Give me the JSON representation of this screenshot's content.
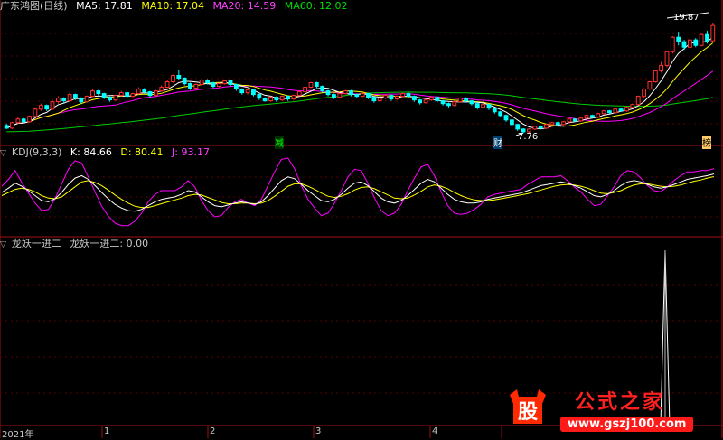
{
  "main_header": {
    "title": "广东鸿图(日线)",
    "ma": [
      {
        "label": "MA5: 17.81",
        "color": "#ffffff"
      },
      {
        "label": "MA10: 17.04",
        "color": "#ffff00"
      },
      {
        "label": "MA20: 14.59",
        "color": "#ff00ff"
      },
      {
        "label": "MA60: 12.02",
        "color": "#00e000"
      }
    ]
  },
  "kdj_header": {
    "title": "KDJ(9,3,3)",
    "k": "K: 84.66",
    "d": "D: 80.41",
    "j": "J: 93.17",
    "colors": {
      "k": "#ffffff",
      "d": "#ffff00",
      "j": "#ff00ff"
    }
  },
  "ind_header": {
    "title": "龙妖一进二",
    "value": "龙妖一进二: 0.00"
  },
  "markers": {
    "high": "19.87",
    "low": "7.76",
    "tag_jian": "减",
    "tag_cai": "财",
    "tag_right": "榜"
  },
  "time_axis": [
    "2021年",
    "1",
    "2",
    "3",
    "4"
  ],
  "watermark": {
    "glyph": "股",
    "text": "公式之家",
    "url": "www.gszj100.com"
  },
  "chart_data": [
    {
      "type": "candlestick",
      "price_ylim": [
        6.5,
        21
      ],
      "high_label": 19.87,
      "low_label": 7.76,
      "candles": [
        [
          8.6,
          8.3,
          8.8,
          8.2
        ],
        [
          8.3,
          8.9,
          9.0,
          8.2
        ],
        [
          8.9,
          9.3,
          9.5,
          8.8
        ],
        [
          9.3,
          9.0,
          9.4,
          8.9
        ],
        [
          9.0,
          9.6,
          9.7,
          8.9
        ],
        [
          9.6,
          10.4,
          10.6,
          9.5
        ],
        [
          10.4,
          10.8,
          11.0,
          10.2
        ],
        [
          10.8,
          10.4,
          10.9,
          10.2
        ],
        [
          10.4,
          11.2,
          11.4,
          10.3
        ],
        [
          11.2,
          11.6,
          11.8,
          11.0
        ],
        [
          11.6,
          11.3,
          11.7,
          11.0
        ],
        [
          11.3,
          12.0,
          12.2,
          11.2
        ],
        [
          12.0,
          11.6,
          12.1,
          11.4
        ],
        [
          11.6,
          11.2,
          11.7,
          11.0
        ],
        [
          11.2,
          11.8,
          11.9,
          11.1
        ],
        [
          11.8,
          12.4,
          12.6,
          11.7
        ],
        [
          12.4,
          12.1,
          12.5,
          11.9
        ],
        [
          12.1,
          11.7,
          12.2,
          11.5
        ],
        [
          11.7,
          11.4,
          11.8,
          11.2
        ],
        [
          11.4,
          11.9,
          12.0,
          11.3
        ],
        [
          11.9,
          12.2,
          12.4,
          11.8
        ],
        [
          12.2,
          11.8,
          12.3,
          11.6
        ],
        [
          11.8,
          12.1,
          12.2,
          11.7
        ],
        [
          12.1,
          12.6,
          12.8,
          12.0
        ],
        [
          12.6,
          12.3,
          12.7,
          12.1
        ],
        [
          12.3,
          11.9,
          12.4,
          11.7
        ],
        [
          11.9,
          12.4,
          12.5,
          11.8
        ],
        [
          12.4,
          12.8,
          13.0,
          12.3
        ],
        [
          12.8,
          13.4,
          13.6,
          12.7
        ],
        [
          13.4,
          14.1,
          14.2,
          13.3
        ],
        [
          14.1,
          13.8,
          14.7,
          13.6
        ],
        [
          13.8,
          13.2,
          13.9,
          13.0
        ],
        [
          13.2,
          12.7,
          13.3,
          12.5
        ],
        [
          12.7,
          13.1,
          13.2,
          12.5
        ],
        [
          13.1,
          13.6,
          13.7,
          13.0
        ],
        [
          13.6,
          13.3,
          13.7,
          13.1
        ],
        [
          13.3,
          12.9,
          13.4,
          12.7
        ],
        [
          12.9,
          13.2,
          13.3,
          12.8
        ],
        [
          13.2,
          13.5,
          13.6,
          13.1
        ],
        [
          13.5,
          13.1,
          13.6,
          12.9
        ],
        [
          13.1,
          12.6,
          13.2,
          12.4
        ],
        [
          12.6,
          12.2,
          12.7,
          12.0
        ],
        [
          12.2,
          12.5,
          12.6,
          12.0
        ],
        [
          12.5,
          12.0,
          12.6,
          11.8
        ],
        [
          12.0,
          11.6,
          12.1,
          11.4
        ],
        [
          11.6,
          11.3,
          11.7,
          11.2
        ],
        [
          11.3,
          11.7,
          11.8,
          11.2
        ],
        [
          11.7,
          11.4,
          11.8,
          11.2
        ],
        [
          11.4,
          11.8,
          11.9,
          11.3
        ],
        [
          11.8,
          11.5,
          11.9,
          11.3
        ],
        [
          11.5,
          11.9,
          12.0,
          11.4
        ],
        [
          11.9,
          12.3,
          12.4,
          11.8
        ],
        [
          12.3,
          12.8,
          12.9,
          12.2
        ],
        [
          12.8,
          13.3,
          13.4,
          12.7
        ],
        [
          13.3,
          12.9,
          13.4,
          12.7
        ],
        [
          12.9,
          12.4,
          13.0,
          12.2
        ],
        [
          12.4,
          12.0,
          12.5,
          11.8
        ],
        [
          12.0,
          11.7,
          12.1,
          11.5
        ],
        [
          11.7,
          12.1,
          12.2,
          11.6
        ],
        [
          12.1,
          12.4,
          12.5,
          12.0
        ],
        [
          12.4,
          12.0,
          12.5,
          11.8
        ],
        [
          12.0,
          11.8,
          12.1,
          11.6
        ],
        [
          11.8,
          12.1,
          12.2,
          11.7
        ],
        [
          12.1,
          11.7,
          12.2,
          11.5
        ],
        [
          11.7,
          11.3,
          11.8,
          11.1
        ],
        [
          11.3,
          11.6,
          11.7,
          11.2
        ],
        [
          11.6,
          11.9,
          12.0,
          11.5
        ],
        [
          11.9,
          11.5,
          12.0,
          11.3
        ],
        [
          11.5,
          11.8,
          11.9,
          11.4
        ],
        [
          11.8,
          12.1,
          12.2,
          11.7
        ],
        [
          12.1,
          11.8,
          12.2,
          11.6
        ],
        [
          11.8,
          11.4,
          11.9,
          11.2
        ],
        [
          11.4,
          11.1,
          11.5,
          10.9
        ],
        [
          11.1,
          11.4,
          11.5,
          11.0
        ],
        [
          11.4,
          11.7,
          11.8,
          11.3
        ],
        [
          11.7,
          11.3,
          11.8,
          11.1
        ],
        [
          11.3,
          11.0,
          11.4,
          10.8
        ],
        [
          11.0,
          10.8,
          11.1,
          10.6
        ],
        [
          10.8,
          11.2,
          11.3,
          10.7
        ],
        [
          11.2,
          11.6,
          11.7,
          11.1
        ],
        [
          11.6,
          11.3,
          11.7,
          11.1
        ],
        [
          11.3,
          11.0,
          11.4,
          10.8
        ],
        [
          11.0,
          10.6,
          11.1,
          10.4
        ],
        [
          10.6,
          10.9,
          11.0,
          10.5
        ],
        [
          10.9,
          10.5,
          11.0,
          10.3
        ],
        [
          10.5,
          10.1,
          10.6,
          9.9
        ],
        [
          10.1,
          9.7,
          10.2,
          9.5
        ],
        [
          9.7,
          9.2,
          9.8,
          9.0
        ],
        [
          9.2,
          8.7,
          9.3,
          8.5
        ],
        [
          8.7,
          8.2,
          8.8,
          8.0
        ],
        [
          8.2,
          7.9,
          8.3,
          7.76
        ],
        [
          7.9,
          8.2,
          8.3,
          7.8
        ],
        [
          8.2,
          8.5,
          8.6,
          8.1
        ],
        [
          8.5,
          8.3,
          8.6,
          8.2
        ],
        [
          8.3,
          8.7,
          8.8,
          8.2
        ],
        [
          8.7,
          8.9,
          9.0,
          8.6
        ],
        [
          8.9,
          8.7,
          9.0,
          8.6
        ],
        [
          8.7,
          9.0,
          9.1,
          8.6
        ],
        [
          9.0,
          9.3,
          9.4,
          8.9
        ],
        [
          9.3,
          9.1,
          9.4,
          9.0
        ],
        [
          9.1,
          9.4,
          9.5,
          9.0
        ],
        [
          9.4,
          9.7,
          9.8,
          9.3
        ],
        [
          9.7,
          9.5,
          9.8,
          9.4
        ],
        [
          9.5,
          9.9,
          10.0,
          9.4
        ],
        [
          9.9,
          10.2,
          10.3,
          9.8
        ],
        [
          10.2,
          10.0,
          10.3,
          9.9
        ],
        [
          10.0,
          10.4,
          10.5,
          9.9
        ],
        [
          10.4,
          10.2,
          10.5,
          10.1
        ],
        [
          10.2,
          10.6,
          10.7,
          10.1
        ],
        [
          10.6,
          10.9,
          11.0,
          10.5
        ],
        [
          10.9,
          11.8,
          11.9,
          10.8
        ],
        [
          11.8,
          12.6,
          12.7,
          11.7
        ],
        [
          12.6,
          13.4,
          13.5,
          12.5
        ],
        [
          13.4,
          14.6,
          14.7,
          13.3
        ],
        [
          14.6,
          15.2,
          15.6,
          14.4
        ],
        [
          15.2,
          16.7,
          16.8,
          15.0
        ],
        [
          16.7,
          18.3,
          18.4,
          16.5
        ],
        [
          18.3,
          17.8,
          18.9,
          17.4
        ],
        [
          17.8,
          17.2,
          18.0,
          16.9
        ],
        [
          17.2,
          18.0,
          18.1,
          17.0
        ],
        [
          18.0,
          17.4,
          18.2,
          17.2
        ],
        [
          17.4,
          18.6,
          18.7,
          17.3
        ],
        [
          18.6,
          17.9,
          19.0,
          17.6
        ],
        [
          17.9,
          19.6,
          19.87,
          17.8
        ]
      ],
      "ma_periods": [
        5,
        10,
        20,
        60
      ]
    },
    {
      "type": "line",
      "name": "KDJ(9,3,3)",
      "ylim": [
        -10,
        110
      ],
      "series": [
        {
          "name": "K",
          "values": [
            55,
            62,
            70,
            65,
            58,
            50,
            42,
            40,
            45,
            55,
            68,
            78,
            82,
            76,
            66,
            55,
            45,
            36,
            30,
            26,
            25,
            28,
            34,
            40,
            44,
            46,
            48,
            52,
            58,
            56,
            48,
            40,
            34,
            32,
            35,
            38,
            40,
            38,
            36,
            40,
            50,
            62,
            74,
            80,
            77,
            68,
            58,
            50,
            42,
            40,
            44,
            52,
            62,
            70,
            72,
            66,
            56,
            46,
            40,
            38,
            42,
            50,
            60,
            70,
            76,
            72,
            62,
            52,
            44,
            40,
            38,
            38,
            40,
            44,
            46,
            48,
            50,
            52,
            54,
            58,
            62,
            66,
            68,
            70,
            72,
            70,
            66,
            62,
            56,
            50,
            48,
            52,
            58,
            66,
            72,
            74,
            72,
            68,
            64,
            62,
            64,
            68,
            72,
            76,
            78,
            80,
            82,
            84.66
          ]
        },
        {
          "name": "D",
          "values": [
            50,
            55,
            60,
            62,
            60,
            56,
            50,
            46,
            45,
            48,
            56,
            64,
            72,
            74,
            71,
            66,
            59,
            51,
            44,
            38,
            33,
            31,
            31,
            34,
            37,
            40,
            43,
            46,
            50,
            52,
            51,
            47,
            43,
            39,
            37,
            37,
            38,
            38,
            37,
            38,
            42,
            49,
            57,
            65,
            69,
            69,
            65,
            60,
            54,
            49,
            47,
            49,
            53,
            59,
            63,
            64,
            61,
            56,
            51,
            46,
            45,
            46,
            51,
            57,
            64,
            67,
            65,
            61,
            55,
            50,
            46,
            43,
            42,
            42,
            43,
            45,
            47,
            49,
            51,
            53,
            56,
            59,
            62,
            65,
            67,
            68,
            67,
            65,
            62,
            58,
            54,
            53,
            55,
            58,
            63,
            67,
            69,
            69,
            67,
            65,
            64,
            65,
            67,
            70,
            73,
            75,
            78,
            80.41
          ]
        },
        {
          "name": "J",
          "values": [
            65,
            76,
            90,
            71,
            54,
            38,
            26,
            28,
            45,
            69,
            92,
            106,
            102,
            80,
            56,
            33,
            17,
            6,
            2,
            2,
            9,
            22,
            40,
            52,
            58,
            58,
            58,
            64,
            74,
            64,
            42,
            26,
            16,
            18,
            31,
            40,
            44,
            38,
            34,
            44,
            66,
            88,
            108,
            110,
            93,
            66,
            44,
            30,
            18,
            22,
            38,
            58,
            80,
            92,
            90,
            70,
            46,
            26,
            18,
            22,
            36,
            58,
            78,
            96,
            100,
            82,
            56,
            34,
            22,
            20,
            22,
            28,
            36,
            48,
            52,
            54,
            56,
            58,
            60,
            68,
            74,
            80,
            80,
            80,
            82,
            74,
            64,
            56,
            44,
            34,
            36,
            50,
            64,
            82,
            90,
            88,
            78,
            66,
            58,
            56,
            64,
            74,
            82,
            88,
            88,
            90,
            90,
            93.17
          ]
        }
      ]
    },
    {
      "type": "line",
      "name": "龙妖一进二",
      "ylim": [
        0,
        1
      ],
      "spike_index": 115,
      "spike_value": 1,
      "value": 0.0
    }
  ]
}
